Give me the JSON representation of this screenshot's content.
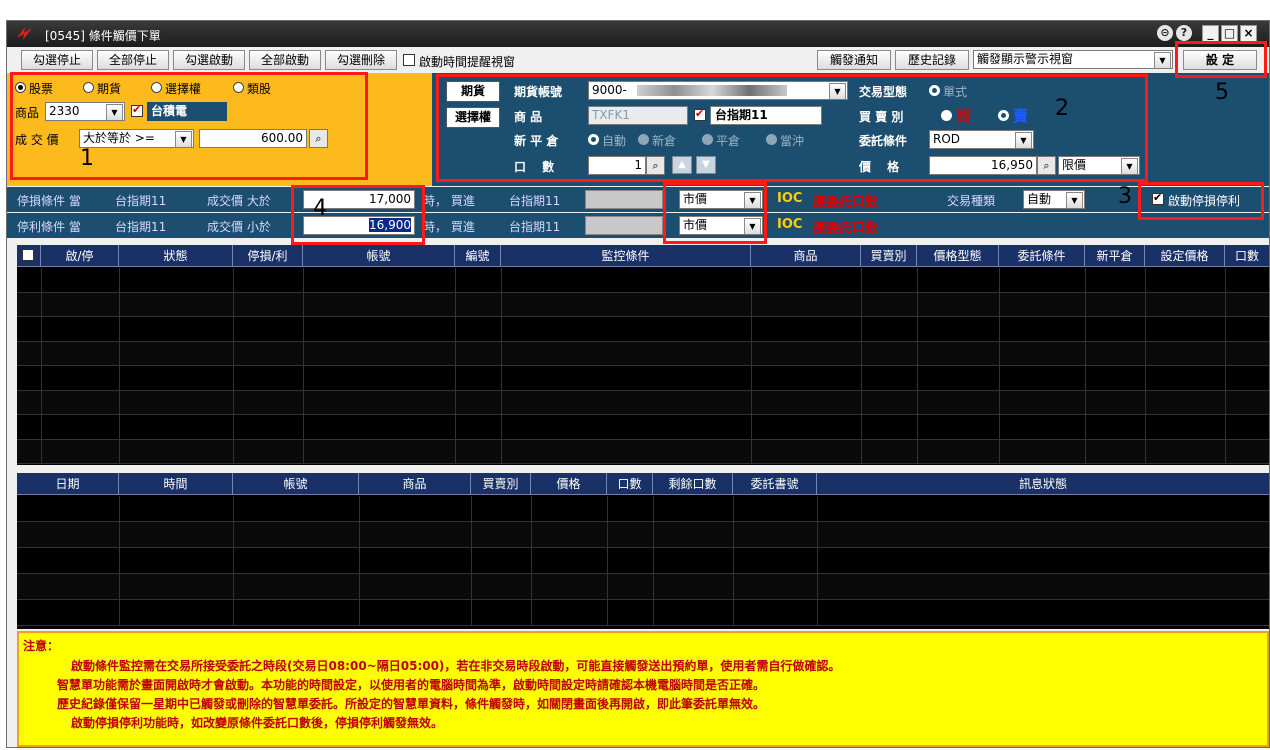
{
  "window": {
    "title": "[0545] 條件觸價下單",
    "title_buttons": [
      "⊝",
      "?",
      "_",
      "□",
      "×"
    ]
  },
  "toolbar": {
    "buttons_left": [
      "勾選停止",
      "全部停止",
      "勾選啟動",
      "全部啟動",
      "勾選刪除"
    ],
    "remind_checkbox_label": "啟動時間提醒視窗",
    "buttons_right": [
      "觸發通知",
      "歷史記錄"
    ],
    "display_select": "觸發顯示警示視窗",
    "settings_button": "設 定"
  },
  "stock_panel": {
    "types": [
      "股票",
      "期貨",
      "選擇權",
      "類股"
    ],
    "selected_type": "股票",
    "product_label": "商品",
    "product_code": "2330",
    "product_name": "台積電",
    "price_label": "成 交 價",
    "compare_select": "大於等於 >=",
    "price_value": "600.00"
  },
  "futures_panel": {
    "tab_futures": "期貨",
    "tab_options": "選擇權",
    "account_label": "期貨帳號",
    "account_value": "9000-",
    "product_label": "商 品",
    "product_code": "TXFK1",
    "product_name": "台指期11",
    "open_close_label": "新 平 倉",
    "open_close_options": [
      "自動",
      "新倉",
      "平倉",
      "當沖"
    ],
    "lots_label": "口　 數",
    "lots_value": "1",
    "trade_type_label": "交易型態",
    "trade_type_value": "單式",
    "side_label": "買 賣 別",
    "side_buy": "買",
    "side_sell": "賣",
    "order_cond_label": "委託條件",
    "order_cond_value": "ROD",
    "price_label": "價　 格",
    "price_value": "16,950",
    "price_type": "限價"
  },
  "stop_loss": {
    "label": "停損條件 當",
    "product": "台指期11",
    "cond_text": "成交價 大於",
    "price": "17,000",
    "action_text": "時， 買進",
    "product2": "台指期11",
    "order_type": "市價",
    "ioc_label": "IOC",
    "lots_text": "原委託口數",
    "trade_kind_label": "交易種類",
    "trade_kind_value": "自動",
    "enable_label": "啟動停損停利"
  },
  "take_profit": {
    "label": "停利條件 當",
    "product": "台指期11",
    "cond_text": "成交價 小於",
    "price": "16,900",
    "action_text": "時， 買進",
    "product2": "台指期11",
    "order_type": "市價",
    "ioc_label": "IOC",
    "lots_text": "原委託口數"
  },
  "monitor_table": {
    "columns": [
      "啟/停",
      "狀態",
      "停損/利",
      "帳號",
      "編號",
      "監控條件",
      "商品",
      "買賣別",
      "價格型態",
      "委託條件",
      "新平倉",
      "設定價格",
      "口數"
    ]
  },
  "log_table": {
    "columns": [
      "日期",
      "時間",
      "帳號",
      "商品",
      "買賣別",
      "價格",
      "口數",
      "剩餘口數",
      "委託書號",
      "訊息狀態"
    ]
  },
  "note": {
    "title": "注意：",
    "lines": [
      "啟動條件監控需在交易所接受委託之時段(交易日08:00~隔日05:00)，若在非交易時段啟動，可能直接觸發送出預約單，使用者需自行做確認。",
      "智慧單功能需於畫面開啟時才會啟動。本功能的時間設定，以使用者的電腦時間為準，啟動時間設定時請確認本機電腦時間是否正確。",
      "歷史紀錄僅保留一星期中已觸發或刪除的智慧單委託。所設定的智慧單資料，條件觸發時，如關閉畫面後再開啟，即此筆委託單無效。",
      "啟動停損停利功能時，如改變原條件委託口數後，停損停利觸發無效。"
    ]
  },
  "annotations": [
    "1",
    "2",
    "3",
    "4",
    "5"
  ],
  "colors": {
    "stock_panel": "#fdba1c",
    "futures_panel": "#1c4e70",
    "grid_header": "#1a3168",
    "note_bg": "#ffff00",
    "highlight_box": "#ff1a1a"
  }
}
